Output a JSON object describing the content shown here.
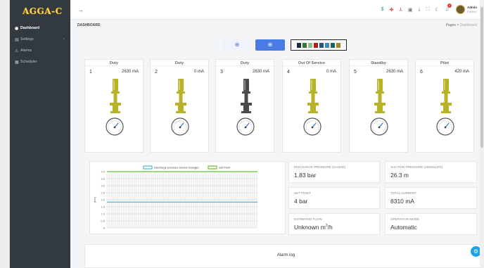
{
  "app": {
    "logo_text": "AGGA-C"
  },
  "sidebar": {
    "items": [
      {
        "icon": "dashboard-icon",
        "glyph": "◉",
        "label": "Dashboard",
        "active": true
      },
      {
        "icon": "settings-icon",
        "glyph": "▤",
        "label": "Settings",
        "chevron": "‹"
      },
      {
        "icon": "alarm-icon",
        "glyph": "⚠",
        "label": "Alarms"
      },
      {
        "icon": "scheduler-icon",
        "glyph": "▦",
        "label": "Scheduler"
      }
    ]
  },
  "topbar": {
    "back_glyph": "→",
    "notification_count": "1",
    "user": {
      "name": "Admin",
      "role": "Factory"
    }
  },
  "breadcrumb": {
    "title": "DASHBOARD",
    "parent": "Pages",
    "separator": ">",
    "current": "Dashboard"
  },
  "controls": {
    "left_glyph": "⊕",
    "right_glyph": "⊕",
    "palette": [
      "#1f2a44",
      "#2e7d32",
      "#8fbc8f",
      "#b71c1c",
      "#26547c",
      "#3c8dbc",
      "#1f5f5f",
      "#9a8c2e"
    ]
  },
  "pumps": [
    {
      "num": "1",
      "status": "Duty",
      "value": "2630 mA",
      "color": "#b8b326"
    },
    {
      "num": "2",
      "status": "Duty",
      "value": "0 mA",
      "color": "#b8b326"
    },
    {
      "num": "3",
      "status": "Duty",
      "value": "2630 mA",
      "color": "#4a4a4a"
    },
    {
      "num": "4",
      "status": "Out Of Service",
      "value": "0 mA",
      "color": "#b8b326"
    },
    {
      "num": "5",
      "status": "Standby",
      "value": "2630 mA",
      "color": "#b8b326"
    },
    {
      "num": "6",
      "status": "Pilot",
      "value": "420 mA",
      "color": "#b8b326"
    }
  ],
  "metrics": [
    {
      "label": "DISCHARGE PRESSURE (GAUGE)",
      "value": "1.83 bar"
    },
    {
      "label": "SUCTION PRESSURE (ABSOLUTE)",
      "value": "26.3 m"
    },
    {
      "label": "SET POINT",
      "value": "4 bar"
    },
    {
      "label": "TOTAL CURRENT",
      "value": "8310 mA"
    },
    {
      "label": "ESTIMATED FLOW",
      "value": "Unknown m",
      "sup": "3",
      "suffix": "/h"
    },
    {
      "label": "OPERATION MODE",
      "value": "Automatic"
    }
  ],
  "chart_data": {
    "type": "line",
    "ylabel": "(bar)",
    "ylim": [
      0,
      4
    ],
    "yticks": [
      "4.0",
      "3.5",
      "3.0",
      "2.5",
      "2.0",
      "1.5",
      "1.0",
      "0.5",
      "0"
    ],
    "legend_position": "top",
    "series": [
      {
        "name": "Discharge pressure sensor (Gauge)",
        "color": "#5ab4d6",
        "values": [
          1.83,
          1.83
        ]
      },
      {
        "name": "Set Point",
        "color": "#66c23a",
        "values": [
          4,
          4
        ]
      }
    ],
    "grid": true
  },
  "alarm_log": {
    "title": "Alarm log"
  },
  "fab_glyph": "⚙"
}
